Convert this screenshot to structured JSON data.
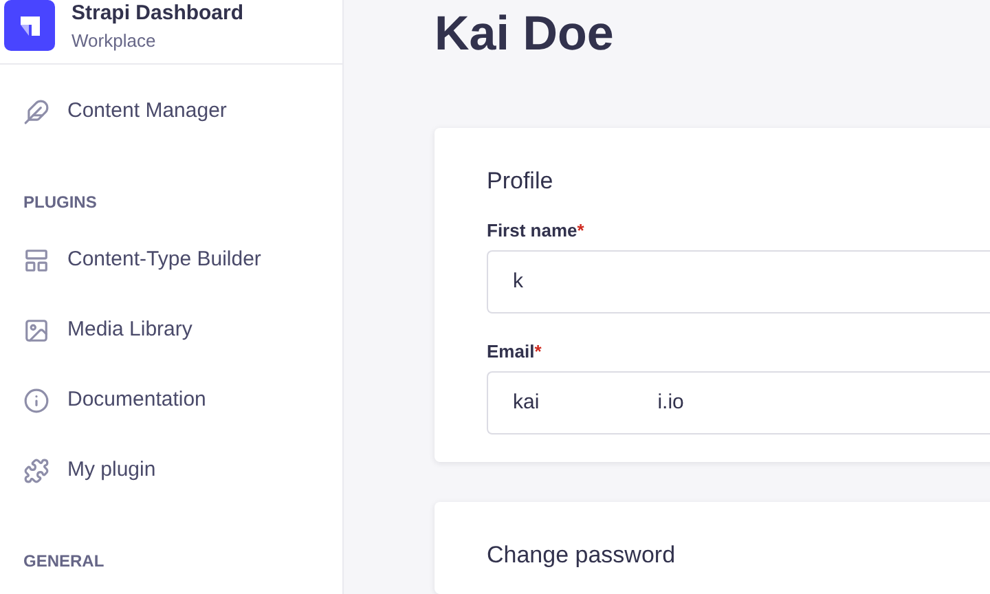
{
  "brand": {
    "title": "Strapi Dashboard",
    "subtitle": "Workplace"
  },
  "sidebar": {
    "items": [
      {
        "kind": "link",
        "label": "Content Manager",
        "selected": false
      },
      {
        "kind": "heading",
        "label": "PLUGINS"
      },
      {
        "kind": "link",
        "label": "Content-Type Builder",
        "selected": false
      },
      {
        "kind": "link",
        "label": "Media Library",
        "selected": false
      },
      {
        "kind": "link",
        "label": "Documentation",
        "selected": false
      },
      {
        "kind": "link",
        "label": "My plugin",
        "selected": false
      },
      {
        "kind": "heading",
        "label": "GENERAL"
      }
    ]
  },
  "page": {
    "title": "Kai Doe"
  },
  "profile": {
    "title": "Profile",
    "fields": [
      {
        "label": "First name",
        "required_mark": "*",
        "value_parts": [
          "k"
        ]
      },
      {
        "label": "Email",
        "required_mark": "*",
        "value_parts": [
          "kai",
          "i.io"
        ]
      }
    ]
  },
  "password": {
    "title": "Change password"
  }
}
